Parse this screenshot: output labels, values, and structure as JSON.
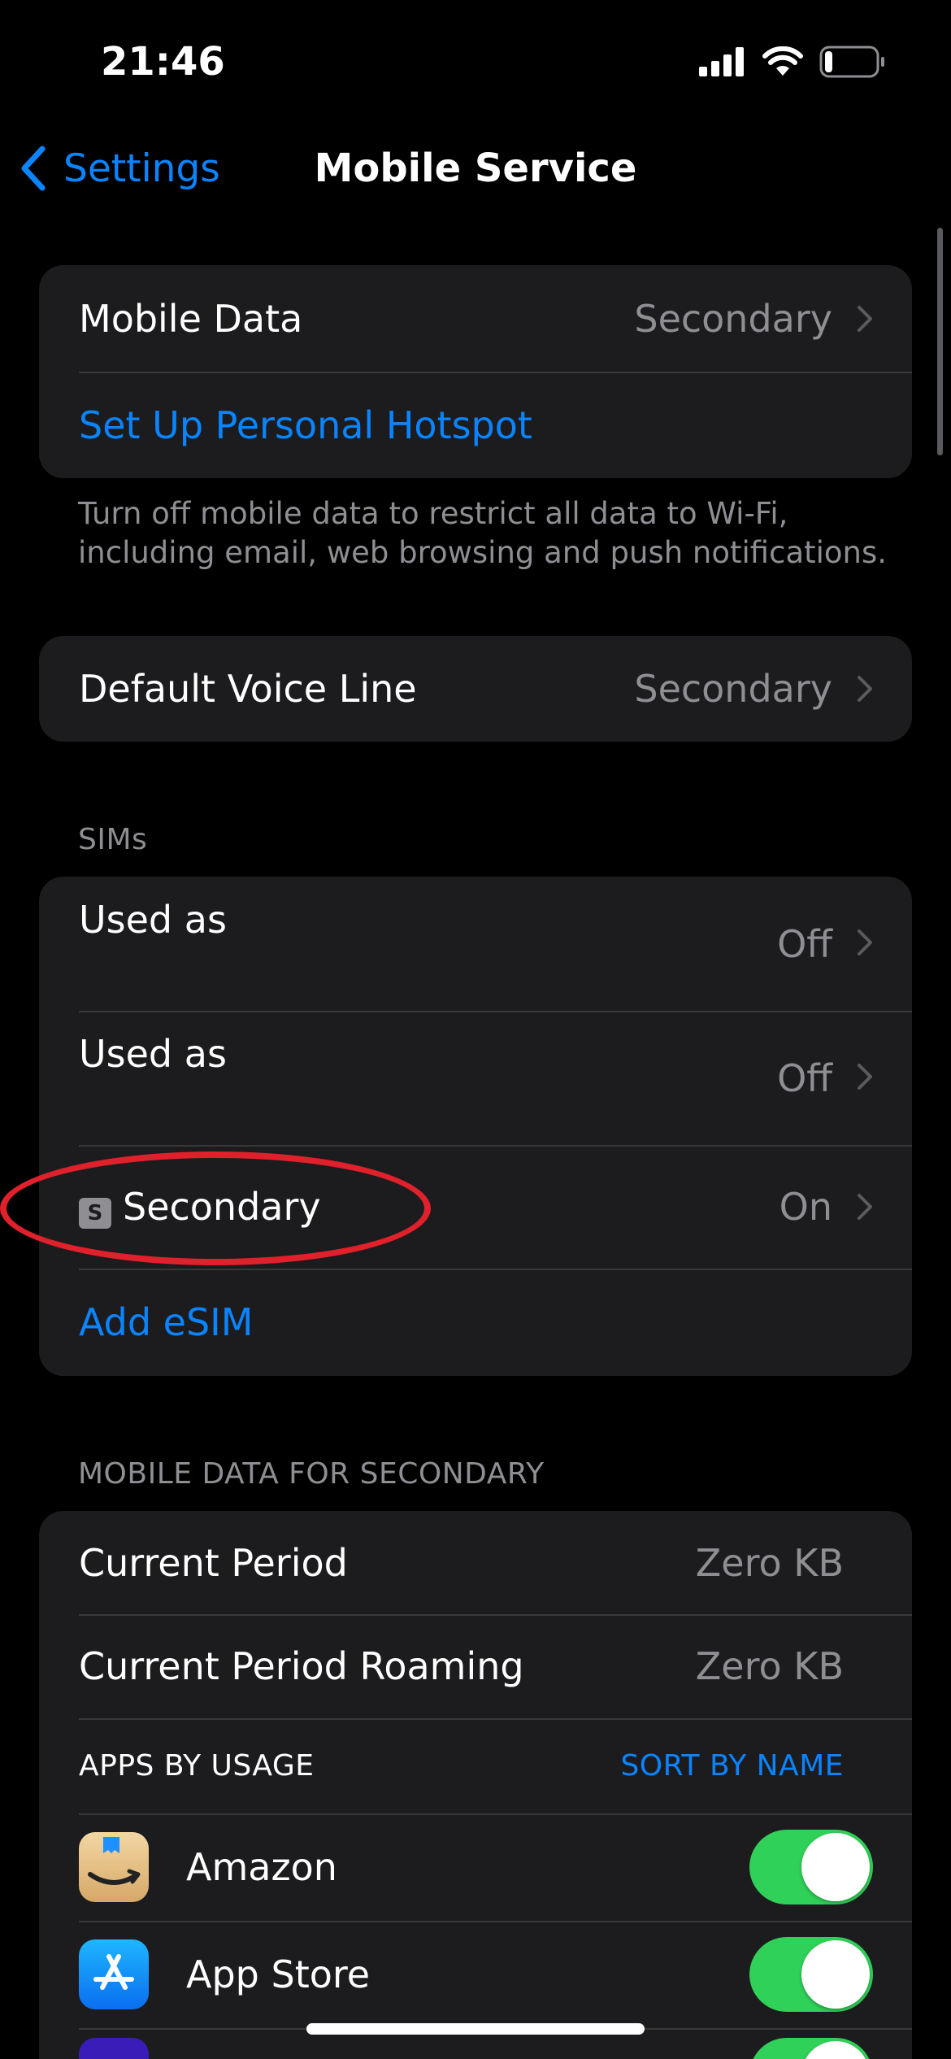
{
  "status_bar": {
    "time": "21:46",
    "battery_level": 0.15
  },
  "nav": {
    "back_label": "Settings",
    "title": "Mobile Service"
  },
  "mobile_data_group": {
    "mobile_data_label": "Mobile Data",
    "mobile_data_value": "Secondary",
    "hotspot_label": "Set Up Personal Hotspot",
    "footnote": "Turn off mobile data to restrict all data to Wi-Fi, including email, web browsing and push notifications."
  },
  "voice_group": {
    "label": "Default Voice Line",
    "value": "Secondary"
  },
  "sims": {
    "header": "SIMs",
    "rows": [
      {
        "label": "Used as",
        "value": "Off"
      },
      {
        "label": "Used as",
        "value": "Off"
      },
      {
        "badge": "S",
        "label": "Secondary",
        "value": "On"
      }
    ],
    "add_esim_label": "Add eSIM"
  },
  "usage": {
    "header": "MOBILE DATA FOR SECONDARY",
    "current_period_label": "Current Period",
    "current_period_value": "Zero KB",
    "roaming_label": "Current Period Roaming",
    "roaming_value": "Zero KB",
    "apps_header": "APPS BY USAGE",
    "sort_label": "SORT BY NAME",
    "apps": [
      {
        "name": "Amazon",
        "icon": "amazon-icon",
        "enabled": true
      },
      {
        "name": "App Store",
        "icon": "app-store-icon",
        "enabled": true
      },
      {
        "name": "",
        "icon": "app-icon",
        "enabled": true
      }
    ]
  },
  "colors": {
    "accent": "#0a84ff",
    "toggle_on": "#30d158",
    "annotation": "#e0202a",
    "cell_bg": "#1c1c1e"
  }
}
